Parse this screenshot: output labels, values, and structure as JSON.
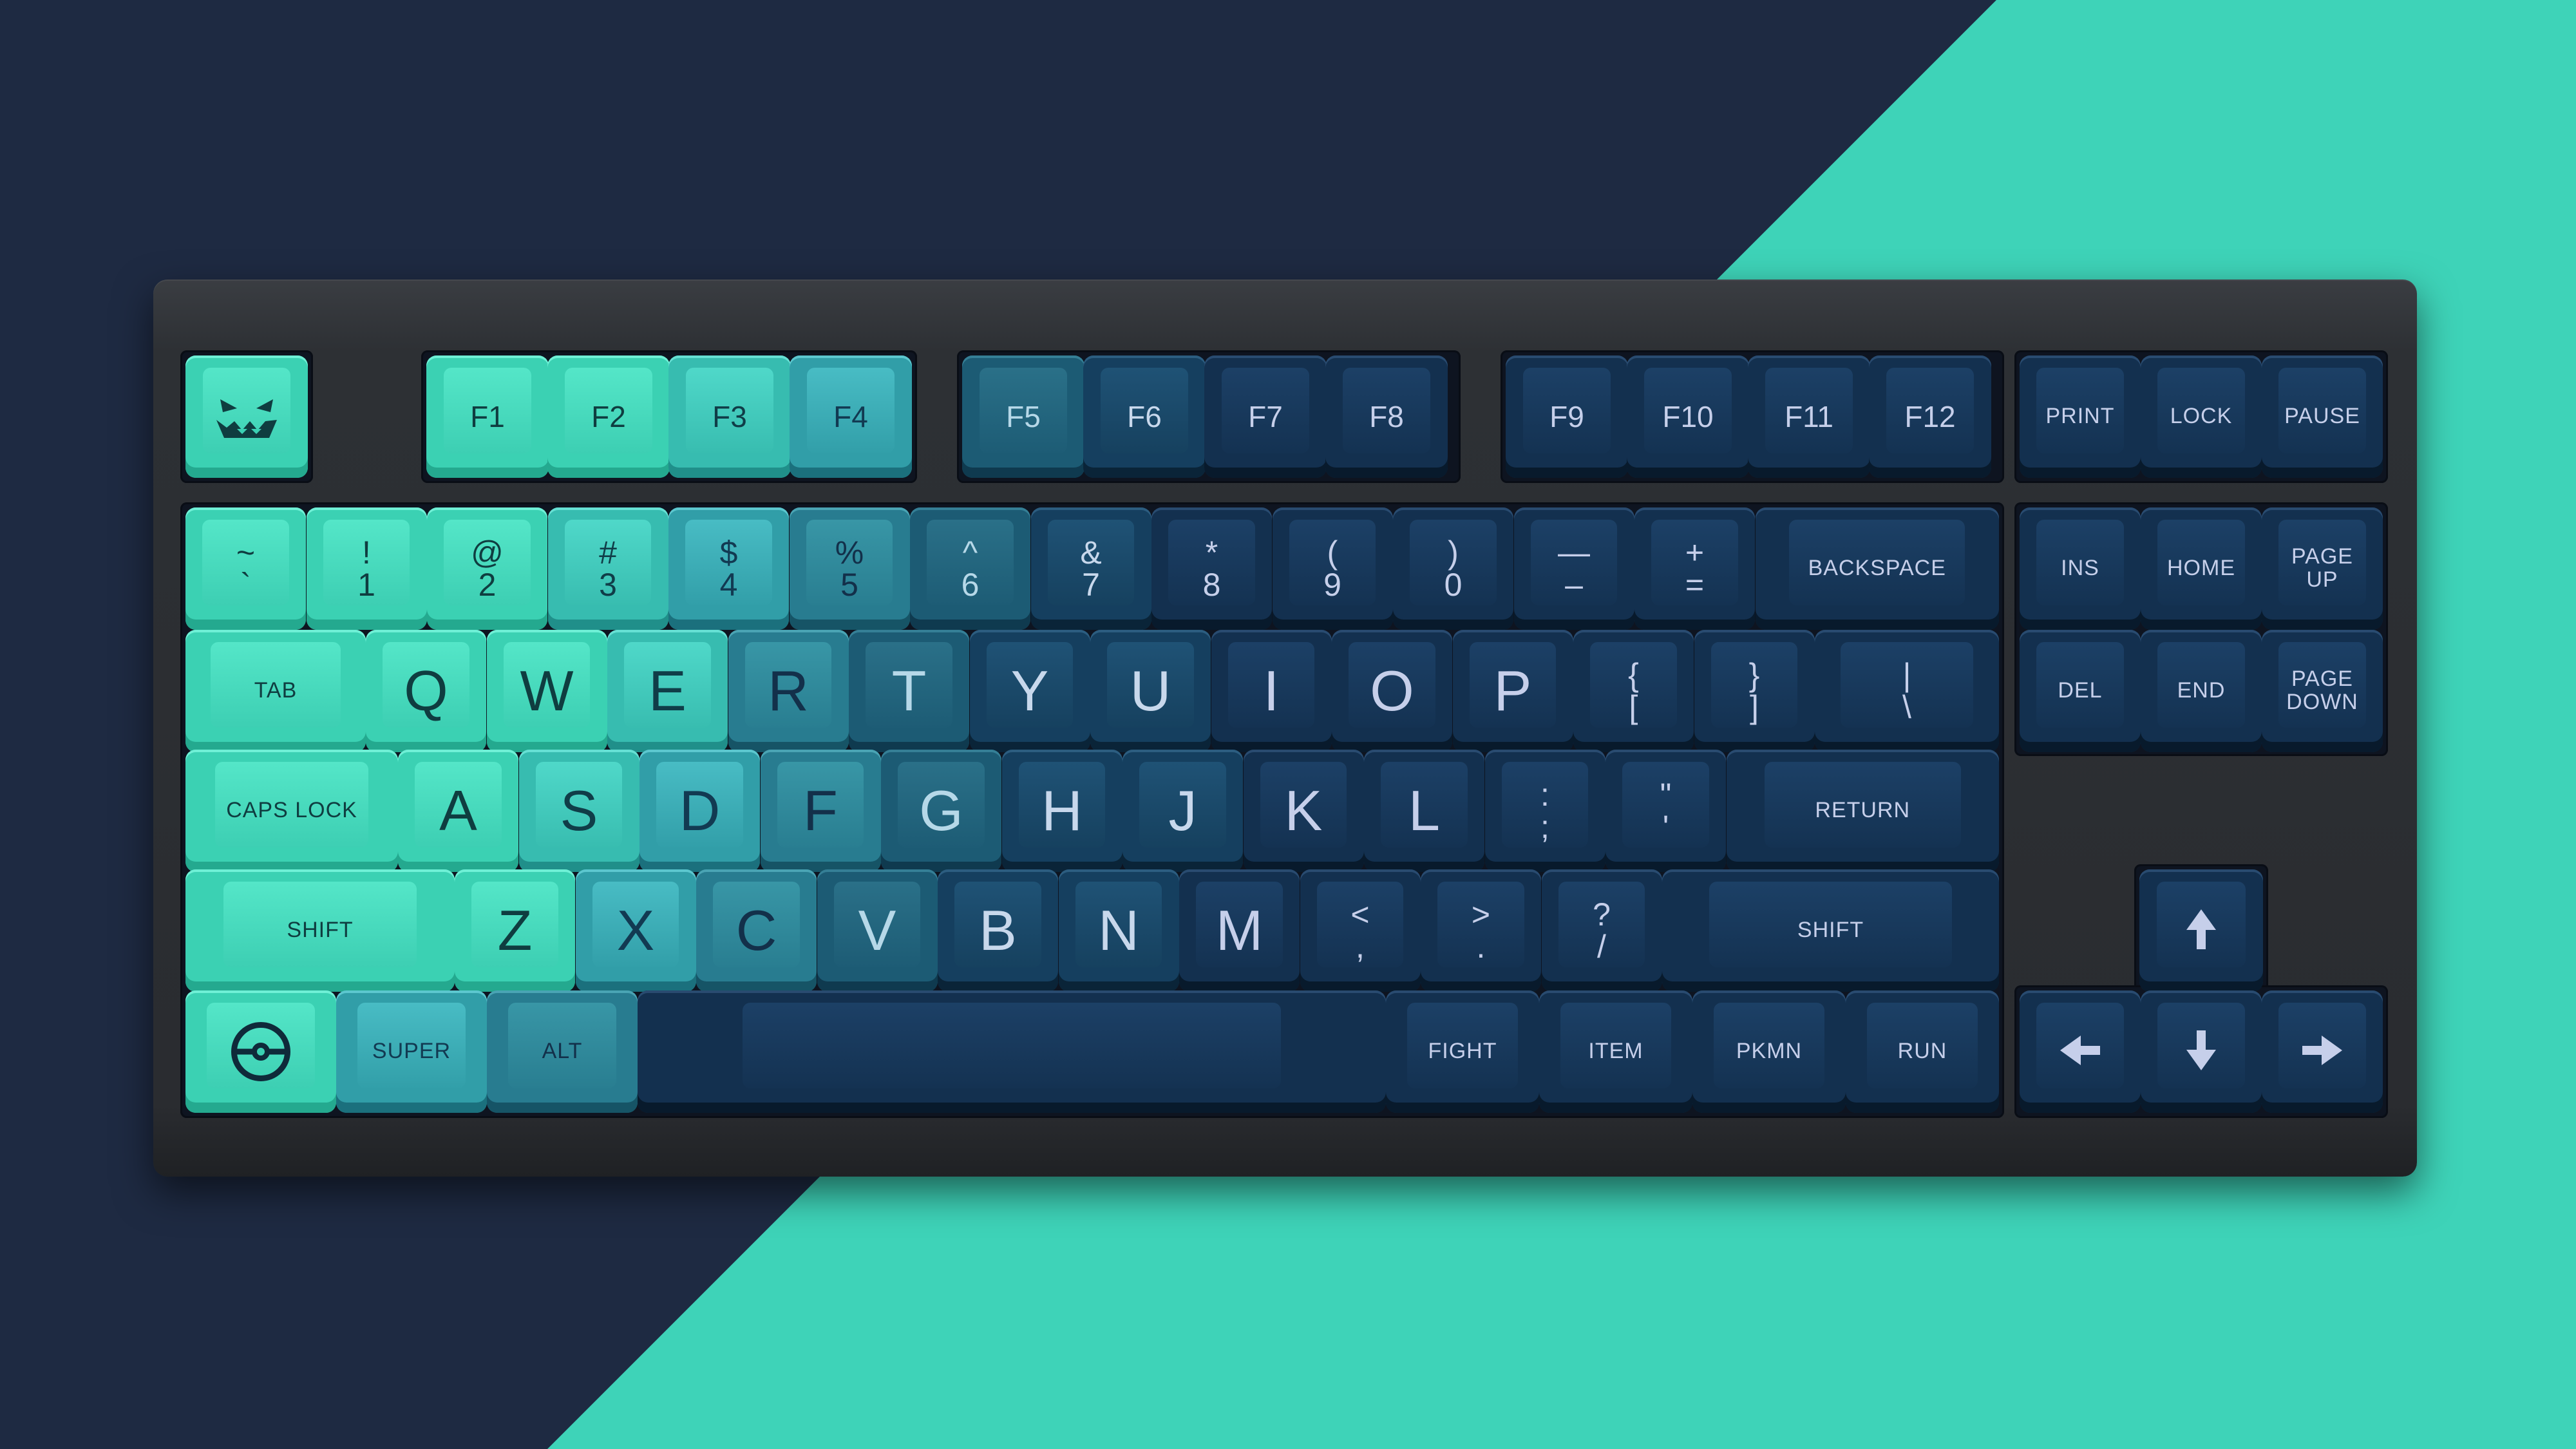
{
  "colors": {
    "background_dark": "#1e2a42",
    "background_accent": "#3ed3b8",
    "case": "#2c2f33",
    "keycap_mint": "#3bd1b3",
    "keycap_navy": "#13304f",
    "legend_light": "#c6cfea"
  },
  "keyboard": {
    "layout": "TKL",
    "function_row": {
      "escape_icon": "jack-o-lantern-icon",
      "f_keys": [
        "F1",
        "F2",
        "F3",
        "F4",
        "F5",
        "F6",
        "F7",
        "F8",
        "F9",
        "F10",
        "F11",
        "F12"
      ],
      "system_keys": [
        "PRINT",
        "LOCK",
        "PAUSE"
      ]
    },
    "number_row": {
      "keys": [
        {
          "shift": "~",
          "base": "`"
        },
        {
          "shift": "!",
          "base": "1"
        },
        {
          "shift": "@",
          "base": "2"
        },
        {
          "shift": "#",
          "base": "3"
        },
        {
          "shift": "$",
          "base": "4"
        },
        {
          "shift": "%",
          "base": "5"
        },
        {
          "shift": "^",
          "base": "6"
        },
        {
          "shift": "&",
          "base": "7"
        },
        {
          "shift": "*",
          "base": "8"
        },
        {
          "shift": "(",
          "base": "9"
        },
        {
          "shift": ")",
          "base": "0"
        },
        {
          "shift": "—",
          "base": "–"
        },
        {
          "shift": "+",
          "base": "="
        }
      ],
      "backspace": "BACKSPACE"
    },
    "top_row": {
      "tab": "TAB",
      "letters": [
        "Q",
        "W",
        "E",
        "R",
        "T",
        "Y",
        "U",
        "I",
        "O",
        "P"
      ],
      "brackets": [
        {
          "shift": "{",
          "base": "["
        },
        {
          "shift": "}",
          "base": "]"
        }
      ],
      "pipe": {
        "shift": "|",
        "base": "\\"
      }
    },
    "home_row": {
      "caps": "CAPS LOCK",
      "letters": [
        "A",
        "S",
        "D",
        "F",
        "G",
        "H",
        "J",
        "K",
        "L"
      ],
      "semicolon": {
        "shift": ":",
        "base": ";"
      },
      "quote": {
        "shift": "\"",
        "base": "'"
      },
      "return": "RETURN"
    },
    "bottom_row": {
      "left_shift": "SHIFT",
      "letters": [
        "Z",
        "X",
        "C",
        "V",
        "B",
        "N",
        "M"
      ],
      "comma": {
        "shift": "<",
        "base": ","
      },
      "period": {
        "shift": ">",
        "base": "."
      },
      "slash": {
        "shift": "?",
        "base": "/"
      },
      "right_shift": "SHIFT"
    },
    "space_row": {
      "left_icon": "pokeball-icon",
      "super": "SUPER",
      "alt": "ALT",
      "right_mods": [
        "FIGHT",
        "ITEM",
        "PKMN",
        "RUN"
      ]
    },
    "nav_cluster": {
      "row1": [
        "INS",
        "HOME",
        "PAGE\nUP"
      ],
      "row2": [
        "DEL",
        "END",
        "PAGE\nDOWN"
      ]
    },
    "arrows": [
      "up-arrow-icon",
      "left-arrow-icon",
      "down-arrow-icon",
      "right-arrow-icon"
    ]
  }
}
